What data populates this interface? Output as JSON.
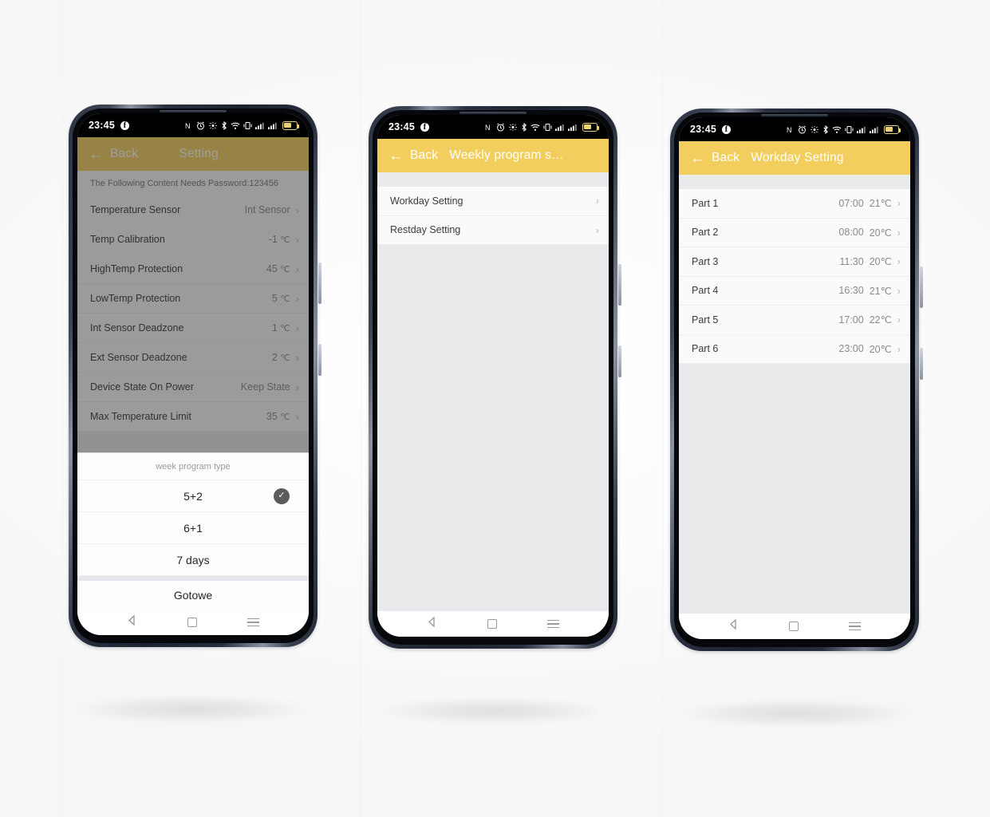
{
  "background_color": "#fbfbfb",
  "theme": {
    "accent": "#f2ce5e",
    "accent_dimmed": "#8c7a33",
    "scrim": "rgba(40,40,40,0.45)"
  },
  "status_bar": {
    "time": "23:45",
    "icons": [
      "facebook-badge",
      "nfc-icon",
      "alarm-icon",
      "location-icon",
      "bluetooth-icon",
      "wifi-icon",
      "vibrate-icon",
      "signal-1-icon",
      "signal-2-icon",
      "battery-icon"
    ]
  },
  "nav_bar": {
    "back": "back-triangle-icon",
    "home": "home-square-icon",
    "recents": "recents-menu-icon"
  },
  "phones": [
    {
      "id": "phone-settings",
      "appbar": {
        "back_label": "Back",
        "title": "Setting",
        "centered": true,
        "dimmed": true
      },
      "note": "The Following Content Needs Password:123456",
      "rows": [
        {
          "label": "Temperature Sensor",
          "value": "Int Sensor",
          "unit": ""
        },
        {
          "label": "Temp Calibration",
          "value": "-1",
          "unit": "℃"
        },
        {
          "label": "HighTemp Protection",
          "value": "45",
          "unit": "℃"
        },
        {
          "label": "LowTemp Protection",
          "value": "5",
          "unit": "℃"
        },
        {
          "label": "Int Sensor Deadzone",
          "value": "1",
          "unit": "℃"
        },
        {
          "label": "Ext Sensor Deadzone",
          "value": "2",
          "unit": "℃"
        },
        {
          "label": "Device State On Power",
          "value": "Keep State",
          "unit": ""
        },
        {
          "label": "Max Temperature Limit",
          "value": "35",
          "unit": "℃"
        }
      ],
      "sheet": {
        "title": "week program type",
        "options": [
          {
            "label": "5+2",
            "selected": true
          },
          {
            "label": "6+1",
            "selected": false
          },
          {
            "label": "7 days",
            "selected": false
          }
        ],
        "done_label": "Gotowe",
        "check_glyph": "✓"
      }
    },
    {
      "id": "phone-weekly-program",
      "appbar": {
        "back_label": "Back",
        "title": "Weekly program s…",
        "centered": false,
        "dimmed": false
      },
      "rows": [
        {
          "label": "Workday Setting",
          "value": "",
          "unit": ""
        },
        {
          "label": "Restday Setting",
          "value": "",
          "unit": ""
        }
      ]
    },
    {
      "id": "phone-workday-setting",
      "appbar": {
        "back_label": "Back",
        "title": "Workday Setting",
        "centered": false,
        "dimmed": false
      },
      "rows": [
        {
          "label": "Part 1",
          "time": "07:00",
          "temp": "21℃"
        },
        {
          "label": "Part 2",
          "time": "08:00",
          "temp": "20℃"
        },
        {
          "label": "Part 3",
          "time": "11:30",
          "temp": "20℃"
        },
        {
          "label": "Part 4",
          "time": "16:30",
          "temp": "21℃"
        },
        {
          "label": "Part 5",
          "time": "17:00",
          "temp": "22℃"
        },
        {
          "label": "Part 6",
          "time": "23:00",
          "temp": "20℃"
        }
      ]
    }
  ],
  "chevron_glyph": "›",
  "arrow_back_glyph": "←"
}
